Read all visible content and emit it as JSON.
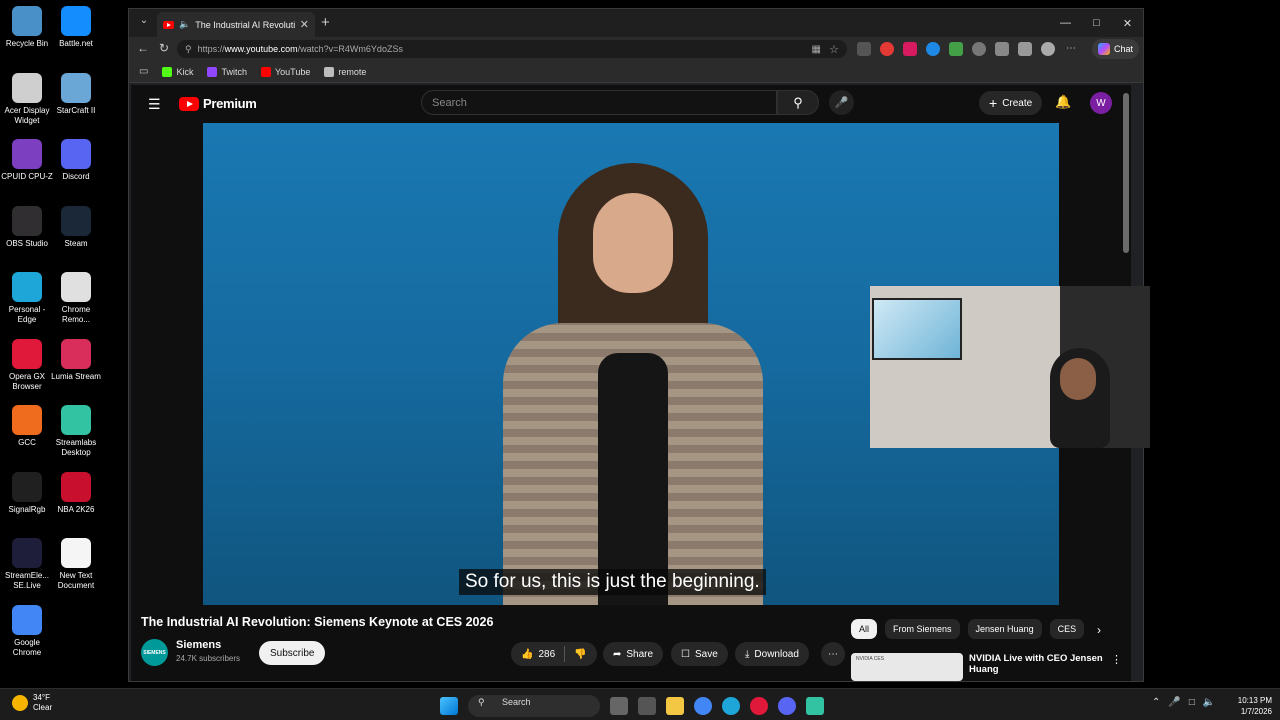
{
  "desktop": {
    "icons": [
      {
        "label": "Recycle Bin",
        "icon": "recycle-bin-icon",
        "color": "#4a90c8"
      },
      {
        "label": "Battle.net",
        "icon": "battlenet-icon",
        "color": "#148eff"
      },
      {
        "label": "Acer Display Widget",
        "icon": "acer-display-widget-icon",
        "color": "#cfcfcf"
      },
      {
        "label": "StarCraft II",
        "icon": "starcraft-icon",
        "color": "#6aa7d6"
      },
      {
        "label": "CPUID CPU-Z",
        "icon": "cpuz-icon",
        "color": "#7b3fbf"
      },
      {
        "label": "Discord",
        "icon": "discord-icon",
        "color": "#5865f2"
      },
      {
        "label": "OBS Studio",
        "icon": "obs-icon",
        "color": "#302e31"
      },
      {
        "label": "Steam",
        "icon": "steam-icon",
        "color": "#1b2838"
      },
      {
        "label": "Personal - Edge",
        "icon": "edge-icon",
        "color": "#1fa6d9"
      },
      {
        "label": "Chrome Remo...",
        "icon": "chrome-remote-icon",
        "color": "#e0e0e0"
      },
      {
        "label": "Opera GX Browser",
        "icon": "opera-gx-icon",
        "color": "#e0193a"
      },
      {
        "label": "Lumia Stream",
        "icon": "lumia-stream-icon",
        "color": "#d92e5c"
      },
      {
        "label": "GCC",
        "icon": "gcc-icon",
        "color": "#ef6c1f"
      },
      {
        "label": "Streamlabs Desktop",
        "icon": "streamlabs-icon",
        "color": "#31c3a2"
      },
      {
        "label": "SignalRgb",
        "icon": "signalrgb-icon",
        "color": "#202020"
      },
      {
        "label": "NBA 2K26",
        "icon": "nba2k-icon",
        "color": "#c8102e"
      },
      {
        "label": "StreamEle... SE.Live",
        "icon": "streamelements-icon",
        "color": "#1e1e3a"
      },
      {
        "label": "New Text Document",
        "icon": "text-document-icon",
        "color": "#f5f5f5"
      },
      {
        "label": "Google Chrome",
        "icon": "chrome-icon",
        "color": "#4285f4"
      }
    ]
  },
  "browser": {
    "tab_title": "The Industrial AI Revolution: S",
    "url_prefix": "https://",
    "url_host": "www.youtube.com",
    "url_path": "/watch?v=R4Wm6YdoZSs",
    "chat_label": "Chat",
    "bookmarks": [
      {
        "label": "Kick",
        "color": "#53fc18"
      },
      {
        "label": "Twitch",
        "color": "#9146ff"
      },
      {
        "label": "YouTube",
        "color": "#ff0000"
      },
      {
        "label": "remote",
        "color": "#bdbdbd"
      }
    ]
  },
  "youtube": {
    "logo_text": "Premium",
    "search_placeholder": "Search",
    "create_label": "Create",
    "avatar_letter": "W",
    "subtitle": "So for us, this is just the beginning.",
    "video_title": "The Industrial AI Revolution: Siemens Keynote at CES 2026",
    "channel_name": "Siemens",
    "channel_logo_text": "SIEMENS",
    "subscribers": "24.7K subscribers",
    "subscribe_label": "Subscribe",
    "likes": "286",
    "share_label": "Share",
    "save_label": "Save",
    "download_label": "Download",
    "chips": [
      "All",
      "From Siemens",
      "Jensen Huang",
      "CES"
    ],
    "recommended": {
      "title": "NVIDIA Live with CEO Jensen Huang",
      "thumb_text": "NVIDIA CES"
    }
  },
  "taskbar": {
    "temperature": "34°F",
    "condition": "Clear",
    "search_label": "Search",
    "time": "10:13 PM",
    "date": "1/7/2026"
  },
  "colors": {
    "youtube_red": "#ff0000",
    "avatar_purple": "#7b1fa2",
    "siemens_teal": "#009999"
  }
}
